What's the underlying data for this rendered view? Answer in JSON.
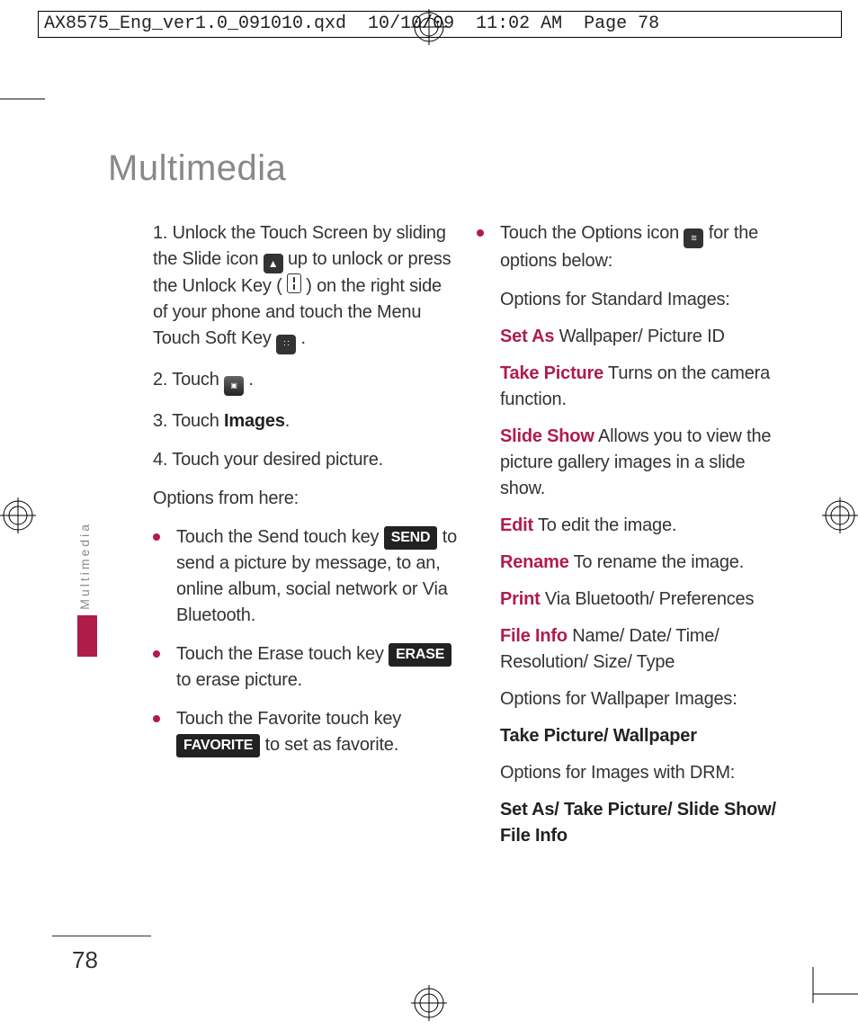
{
  "header": "AX8575_Eng_ver1.0_091010.qxd  10/10/09  11:02 AM  Page 78",
  "title": "Multimedia",
  "side_label": "Multimedia",
  "page_number": "78",
  "left": {
    "s1a": "1. Unlock the Touch Screen by sliding the Slide icon ",
    "s1b": " up to unlock or press the Unlock Key ( ",
    "s1c": " ) on the right side of your phone and touch the Menu Touch Soft Key ",
    "s1d": " .",
    "s2": "2. Touch ",
    "s2b": ".",
    "s3a": "3. Touch ",
    "s3b": "Images",
    "s3c": ".",
    "s4": "4. Touch your desired picture.",
    "opts_header": "Options from here:",
    "b1a": "Touch the Send touch key ",
    "b1btn": "SEND",
    "b1b": " to send a picture by message, to an, online album, social network or Via Bluetooth.",
    "b2a": "Touch the Erase touch key ",
    "b2btn": "ERASE",
    "b2b": " to erase picture.",
    "b3a": "Touch the Favorite touch key ",
    "b3btn": "FAVORITE",
    "b3b": " to set as favorite."
  },
  "right": {
    "b4a": "Touch the Options icon ",
    "b4b": " for the options below:",
    "std": "Options for Standard Images:",
    "setas_l": "Set As",
    "setas_t": " Wallpaper/ Picture ID",
    "take_l": "Take Picture",
    "take_t": "  Turns on the camera function.",
    "slide_l": "Slide Show",
    "slide_t": "  Allows you to view the picture gallery images in a slide show.",
    "edit_l": "Edit",
    "edit_t": "  To edit the image.",
    "ren_l": "Rename",
    "ren_t": "  To rename the image.",
    "print_l": "Print",
    "print_t": "  Via Bluetooth/ Preferences",
    "fi_l": "File Info",
    "fi_t": "  Name/ Date/ Time/ Resolution/ Size/ Type",
    "wall_hdr": "Options for Wallpaper Images:",
    "wall_b": "Take Picture/ Wallpaper",
    "drm_hdr": "Options for Images with DRM:",
    "drm_b": "Set As/ Take Picture/ Slide Show/ File Info"
  }
}
